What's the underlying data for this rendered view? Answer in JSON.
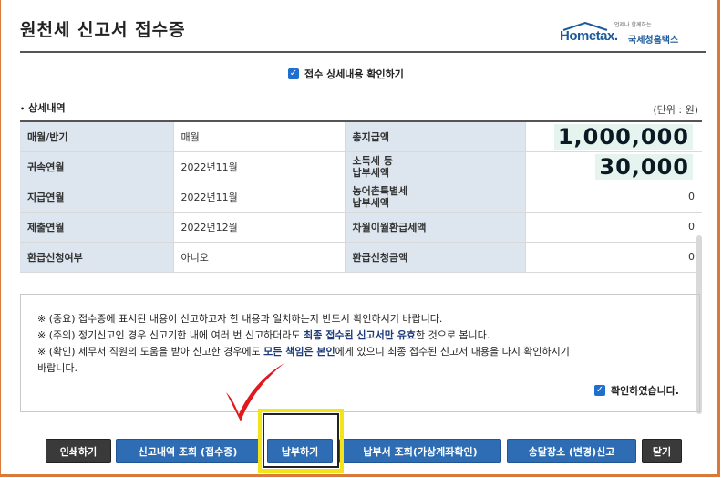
{
  "window": {
    "title": "원천세 신고서 접수증"
  },
  "logo": {
    "brand": "Hometax.",
    "brand_sub": "국세청홈택스",
    "tagline": "언제나 함께하는"
  },
  "detail_checkbox": {
    "label": "접수 상세내용 확인하기",
    "checked": true
  },
  "section": {
    "title": "상세내역",
    "unit": "(단위 : 원)"
  },
  "table": {
    "rows": [
      {
        "l1": "매월/반기",
        "v1": "매월",
        "l2": "총지급액",
        "l2b": "",
        "v2": "1,000,000",
        "big": true
      },
      {
        "l1": "귀속연월",
        "v1": "2022년11월",
        "l2": "소득세 등",
        "l2b": "납부세액",
        "v2": "30,000",
        "big": true
      },
      {
        "l1": "지급연월",
        "v1": "2022년11월",
        "l2": "농어촌특별세",
        "l2b": "납부세액",
        "v2": "0",
        "big": false
      },
      {
        "l1": "제출연월",
        "v1": "2022년12월",
        "l2": "차월이월환급세액",
        "l2b": "",
        "v2": "0",
        "big": false
      },
      {
        "l1": "환급신청여부",
        "v1": "아니오",
        "l2": "환급신청금액",
        "l2b": "",
        "v2": "0",
        "big": false
      }
    ]
  },
  "notice": {
    "line1": "※ (중요) 접수증에 표시된 내용이 신고하고자 한 내용과 일치하는지 반드시 확인하시기 바랍니다.",
    "line2_a": "※ (주의) 정기신고인 경우 신고기한 내에 여러 번 신고하더라도 ",
    "line2_b": "최종 접수된 신고서만 유효",
    "line2_c": "한 것으로 봅니다.",
    "line3_a": "※ (확인) 세무서 직원의 도움을 받아 신고한 경우에도 ",
    "line3_b": "모든 책임은 본인",
    "line3_c": "에게 있으니 최종 접수된 신고서 내용을 다시 확인하시기",
    "line4": "바랍니다.",
    "confirm_label": "확인하였습니다.",
    "confirm_checked": true
  },
  "buttons": {
    "print": "인쇄하기",
    "history": "신고내역 조회 (접수증)",
    "pay": "납부하기",
    "bill": "납부서 조회(가상계좌확인)",
    "delivery": "송달장소 (변경)신고",
    "close": "닫기"
  },
  "colors": {
    "accent": "#2e6db3",
    "highlight": "#f2e418",
    "check_red": "#e0191e"
  }
}
